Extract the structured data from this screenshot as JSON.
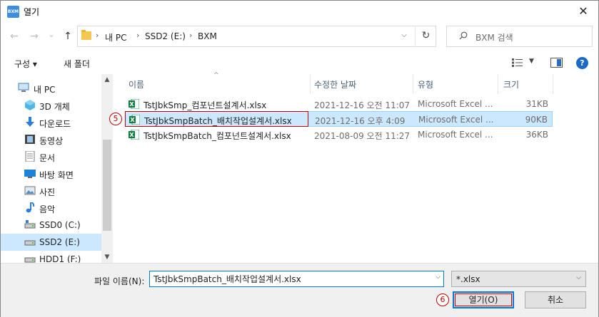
{
  "window": {
    "title": "열기",
    "app_icon_text": "BXM",
    "close_glyph": "✕"
  },
  "nav_buttons": {
    "back": "←",
    "forward": "→",
    "history": "⌄",
    "up": "↑"
  },
  "address": {
    "crumbs": [
      "내 PC",
      "SSD2 (E:)",
      "BXM"
    ],
    "separator": "›",
    "refresh": "↻"
  },
  "search": {
    "placeholder": "BXM 검색"
  },
  "toolbar": {
    "organize_label": "구성 ▾",
    "new_folder_label": "새 폴더",
    "help": "?"
  },
  "navpane": {
    "items": [
      {
        "label": "내 PC",
        "icon": "pc-icon"
      },
      {
        "label": "3D 개체",
        "icon": "3d-objects-icon"
      },
      {
        "label": "다운로드",
        "icon": "download-icon"
      },
      {
        "label": "동영상",
        "icon": "video-icon"
      },
      {
        "label": "문서",
        "icon": "document-icon"
      },
      {
        "label": "바탕 화면",
        "icon": "desktop-icon"
      },
      {
        "label": "사진",
        "icon": "picture-icon"
      },
      {
        "label": "음악",
        "icon": "music-icon"
      },
      {
        "label": "SSD0 (C:)",
        "icon": "drive-icon"
      },
      {
        "label": "SSD2 (E:)",
        "icon": "drive-icon"
      },
      {
        "label": "HDD1 (F:)",
        "icon": "drive-icon"
      }
    ],
    "selected_index": 9
  },
  "filelist": {
    "columns": {
      "name": "이름",
      "date": "수정한 날짜",
      "type": "유형",
      "size": "크기"
    },
    "sort_caret": "^",
    "rows": [
      {
        "name": "TstJbkSmp_컴포넌트설계서.xlsx",
        "date": "2021-12-16 오전 11:07",
        "type": "Microsoft Excel ...",
        "size": "31KB"
      },
      {
        "name": "TstJbkSmpBatch_배치작업설계서.xlsx",
        "date": "2021-12-16 오후 4:09",
        "type": "Microsoft Excel ...",
        "size": "90KB"
      },
      {
        "name": "TstJbkSmpBatch_컴포넌트설계서.xlsx",
        "date": "2021-08-09 오전 11:27",
        "type": "Microsoft Excel ...",
        "size": "36KB"
      }
    ],
    "selected_index": 1
  },
  "annotations": {
    "step5": "5",
    "step6": "6"
  },
  "bottom": {
    "filename_label": "파일 이름(N):",
    "filename_value": "TstJbkSmpBatch_배치작업설계서.xlsx",
    "filter_value": "*.xlsx",
    "open_label": "열기(O)",
    "cancel_label": "취소"
  },
  "colors": {
    "accent": "#0078d7",
    "selection": "#cce8ff",
    "annotation_red": "#c00000"
  }
}
